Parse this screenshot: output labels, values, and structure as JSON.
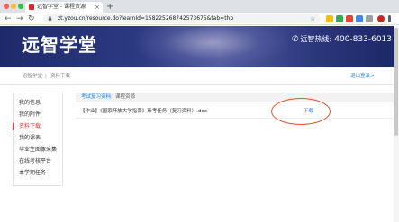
{
  "browser": {
    "tab_title": "远智学堂 - 课程资源",
    "tab_close": "×",
    "new_tab": "+",
    "back": "←",
    "forward": "→",
    "reload": "↻",
    "url": "zt.yzou.cn/resource.do?learnId=158225268742573675&tab=thp",
    "star": "☆"
  },
  "header": {
    "logo_text": "远智学堂",
    "hotline_icon": "phone-icon",
    "hotline_label": "远智热线:",
    "hotline_number": "400-833-6013",
    "colors": {
      "banner": "#2c3a82",
      "text": "#ffffff"
    }
  },
  "breadcrumb": {
    "home": "远智学堂",
    "separator": "|",
    "current": "资料下载",
    "logout": "退出登录>"
  },
  "sidebar": {
    "items": [
      {
        "label": "我的信息",
        "active": false
      },
      {
        "label": "我的附件",
        "active": false
      },
      {
        "label": "资料下载",
        "active": true
      },
      {
        "label": "我的课表",
        "active": false
      },
      {
        "label": "毕业生图像采集",
        "active": false
      },
      {
        "label": "在线考核平台",
        "active": false
      },
      {
        "label": "本学期任务",
        "active": false
      }
    ],
    "active_color": "#e53935"
  },
  "content": {
    "tabs": [
      {
        "label": "考试复习资料",
        "active": true
      },
      {
        "label": "课程资源",
        "active": false
      }
    ],
    "tab_separator": "|",
    "files": [
      {
        "name": "【作业】《国家开放大学指南》形考任务（复习资料）.doc",
        "action": "下载"
      }
    ],
    "link_color": "#1e88e5",
    "highlight_color": "#e0562e"
  }
}
